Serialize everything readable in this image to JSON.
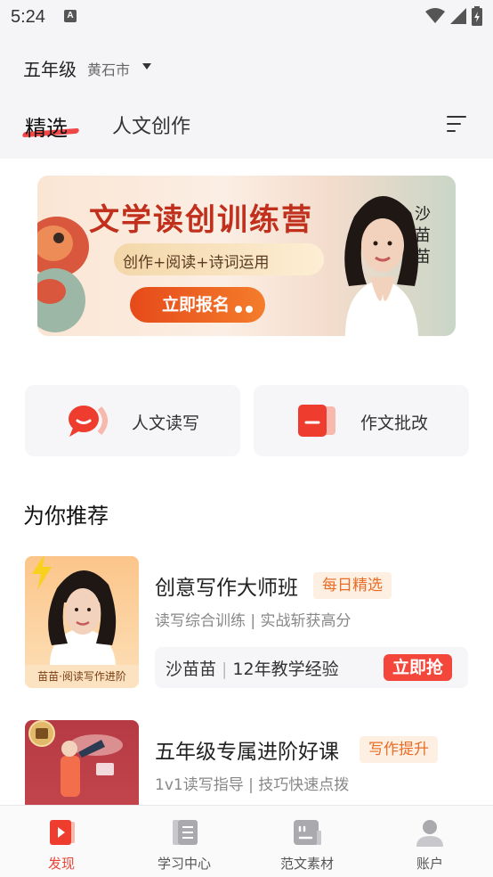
{
  "status_bar": {
    "time": "5:24",
    "notification_glyph": "A"
  },
  "location": {
    "grade": "五年级",
    "city": "黄石市"
  },
  "tabs": [
    {
      "label": "精选",
      "active": true
    },
    {
      "label": "人文创作",
      "active": false
    }
  ],
  "banner": {
    "title": "文学读创训练营",
    "subtitle": "创作+阅读+诗词运用",
    "button": "立即报名",
    "teacher_name": "沙苗苗"
  },
  "quick_entries": [
    {
      "label": "人文读写",
      "icon": "speech-bubble-icon"
    },
    {
      "label": "作文批改",
      "icon": "correction-book-icon"
    }
  ],
  "recommend": {
    "title": "为你推荐",
    "courses": [
      {
        "title": "创意写作大师班",
        "tag": "每日精选",
        "subtitle": "读写综合训练 | 实战斩获高分",
        "thumb_caption": "苗苗·阅读写作进阶",
        "teacher": "沙苗苗",
        "experience": "12年教学经验",
        "button": "立即抢"
      },
      {
        "title": "五年级专属进阶好课",
        "tag": "写作提升",
        "subtitle": "1v1读写指导 | 技巧快速点拨"
      }
    ]
  },
  "bottom_nav": [
    {
      "label": "发现",
      "icon": "discover-icon",
      "active": true
    },
    {
      "label": "学习中心",
      "icon": "study-center-icon",
      "active": false
    },
    {
      "label": "范文素材",
      "icon": "essay-material-icon",
      "active": false
    },
    {
      "label": "账户",
      "icon": "account-icon",
      "active": false
    }
  ],
  "colors": {
    "accent": "#f2473a",
    "tag_bg": "#fdf0e3",
    "tag_text": "#e86c24"
  }
}
